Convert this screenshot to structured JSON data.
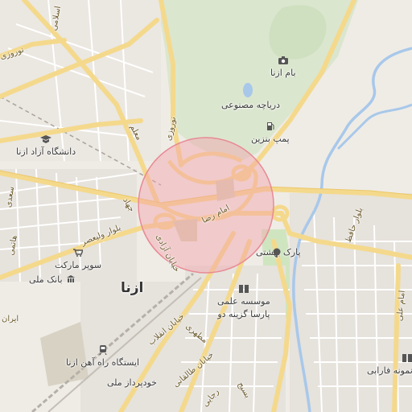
{
  "map": {
    "city_label": "ازنا",
    "highlight_circle_color": "#f3a1ab",
    "roads": {
      "azadi": "خیابان آزادی",
      "imam_reza": "امام رضا",
      "jahad": "جهاد",
      "velayat": "بلوار ولیعصر",
      "mealem": "معلم",
      "noruzi": "نوروزی",
      "enghelab": "خیابان انقلاب",
      "taleghani": "خیابان طالقانی",
      "motahari": "مطهری",
      "rajaee": "رجایی",
      "basij": "بسیج",
      "hafez": "بلوار حافظ",
      "imam_ali": "امام علی",
      "eslami": "اسلامی",
      "noruzi_top": "نوروزی",
      "saadi": "سعدی",
      "hatami": "هاتمی",
      "iran": "ایران"
    },
    "pois": {
      "bam_azna": "بام ازنا",
      "lake": "دریاچه مصنوعی",
      "gas_station": "پمپ بنزین",
      "university": "دانشگاه آزاد ازنا",
      "supermarket": "سوپر مارکت",
      "bank": "بانک ملی",
      "park": "پارک بهشتی",
      "institute_line1": "موسسه علمی",
      "institute_line2": "پارسا گزینه دو",
      "railway_station": "ایستگاه راه آهن ازنا",
      "khodro": "خودپرداز ملی",
      "farabi": "نمونه فارابی"
    }
  }
}
